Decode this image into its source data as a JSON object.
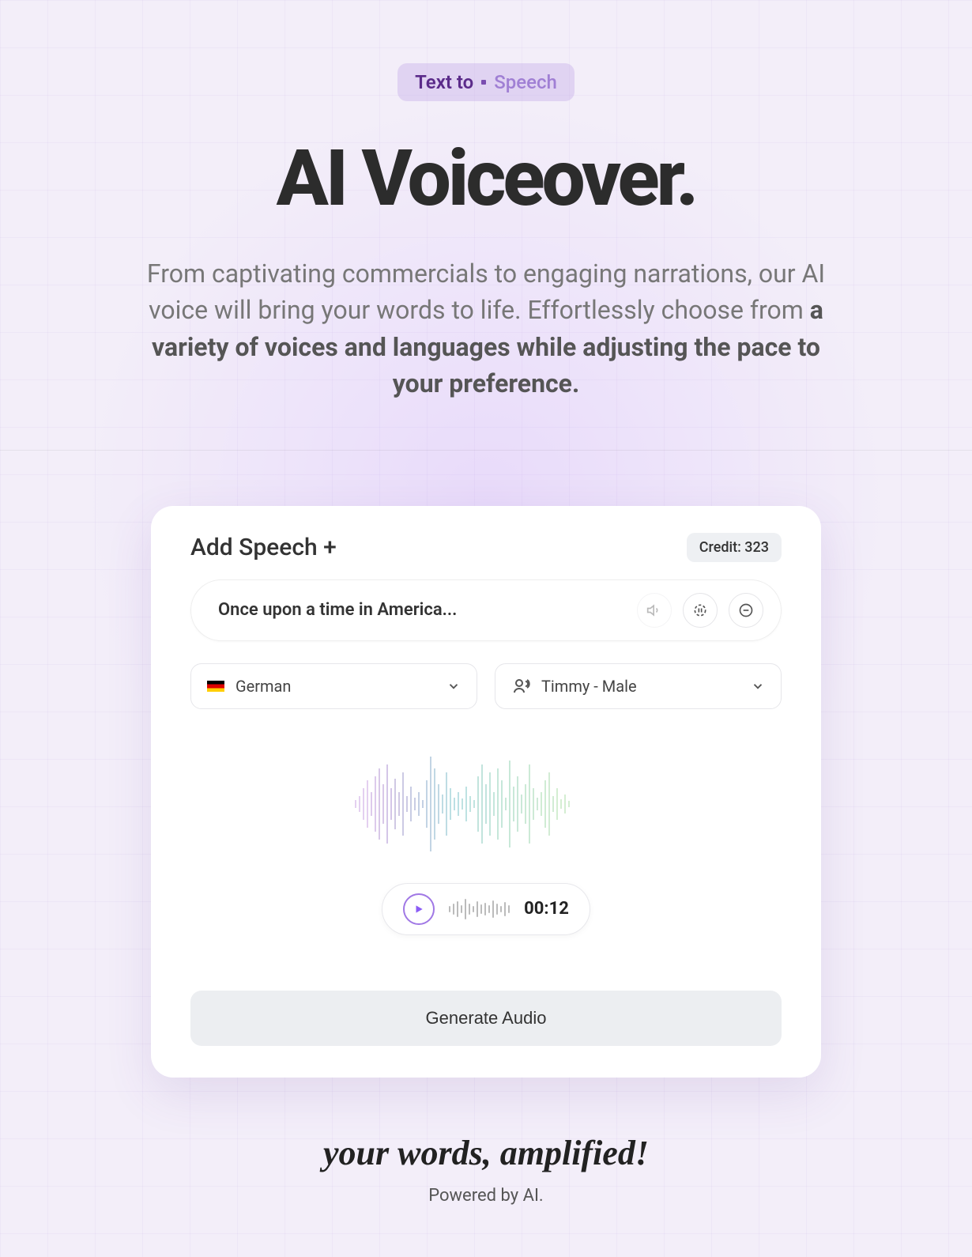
{
  "badge": {
    "left": "Text to",
    "right": "Speech"
  },
  "title": "AI Voiceover.",
  "subtitle": {
    "pre": "From captivating commercials to engaging narrations, our AI voice will bring your words to life. Effortlessly choose from ",
    "bold": "a variety of voices and languages while adjusting the pace to your preference."
  },
  "card": {
    "add_speech": "Add Speech +",
    "credit_label": "Credit: 323",
    "text_input": "Once upon a time in America...",
    "language": {
      "value": "German"
    },
    "voice": {
      "value": "Timmy - Male"
    },
    "timecode": "00:12",
    "generate_label": "Generate Audio"
  },
  "tagline": "your words, amplified!",
  "powered": "Powered by AI."
}
